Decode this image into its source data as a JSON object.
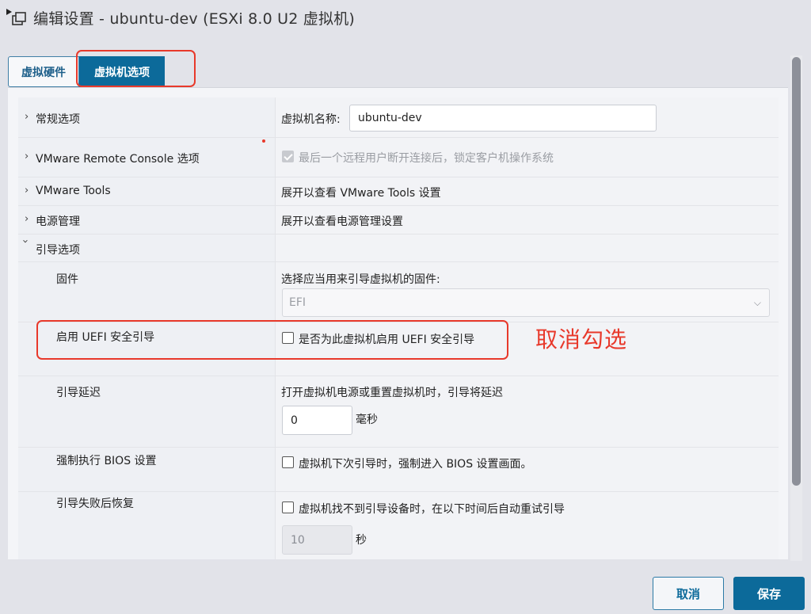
{
  "window": {
    "title": "编辑设置 - ubuntu-dev (ESXi 8.0 U2 虚拟机)"
  },
  "tabs": [
    {
      "label": "虚拟硬件",
      "active": false
    },
    {
      "label": "虚拟机选项",
      "active": true
    }
  ],
  "sections": {
    "general": {
      "label": "常规选项",
      "vm_name_label": "虚拟机名称:",
      "vm_name_value": "ubuntu-dev"
    },
    "remote_console": {
      "label": "VMware Remote Console 选项",
      "lock_guest_text": "最后一个远程用户断开连接后，锁定客户机操作系统",
      "lock_guest_checked": true,
      "lock_guest_disabled": true
    },
    "vmware_tools": {
      "label": "VMware Tools",
      "summary": "展开以查看 VMware Tools 设置"
    },
    "power_management": {
      "label": "电源管理",
      "summary": "展开以查看电源管理设置"
    },
    "boot_options": {
      "label": "引导选项",
      "firmware": {
        "label": "固件",
        "description": "选择应当用来引导虚拟机的固件:",
        "selected": "EFI"
      },
      "secure_boot": {
        "label": "启用 UEFI 安全引导",
        "checkbox_text": "是否为此虚拟机启用 UEFI 安全引导",
        "checked": false
      },
      "boot_delay": {
        "label": "引导延迟",
        "description": "打开虚拟机电源或重置虚拟机时，引导将延迟",
        "value": "0",
        "unit": "毫秒"
      },
      "force_bios": {
        "label": "强制执行 BIOS 设置",
        "checkbox_text": "虚拟机下次引导时，强制进入 BIOS 设置画面。",
        "checked": false
      },
      "failed_boot_recovery": {
        "label": "引导失败后恢复",
        "checkbox_text": "虚拟机找不到引导设备时，在以下时间后自动重试引导",
        "checked": false,
        "value": "10",
        "unit": "秒"
      }
    }
  },
  "annotation": {
    "text": "取消勾选",
    "color": "#e8392b"
  },
  "footer": {
    "cancel_label": "取消",
    "save_label": "保存"
  },
  "colors": {
    "accent": "#0c6a9a",
    "highlight": "#e8392b"
  }
}
